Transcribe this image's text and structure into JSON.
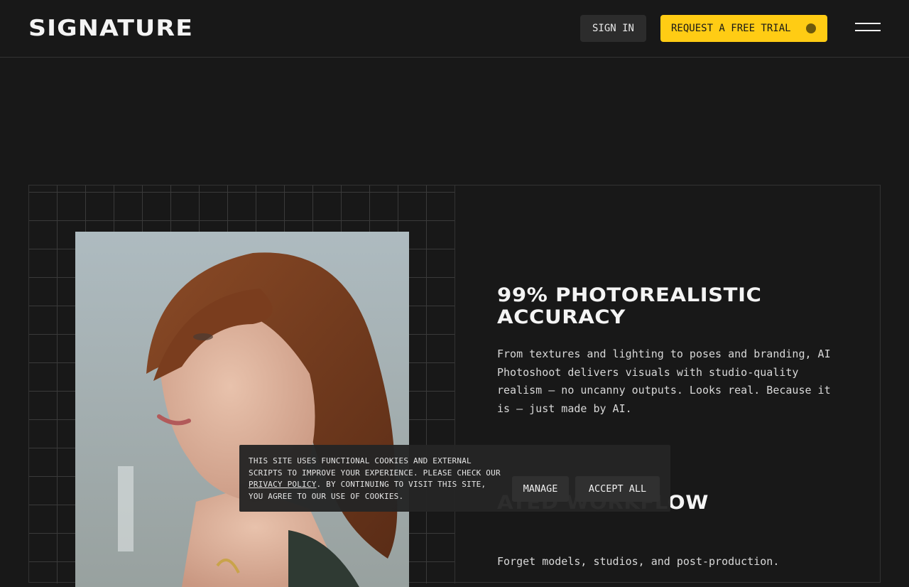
{
  "header": {
    "logo": "SIGNATURE",
    "sign_in_label": "SIGN IN",
    "trial_label": "REQUEST A FREE TRIAL",
    "menu_icon": "hamburger-menu-icon"
  },
  "features": [
    {
      "title": "99% PHOTOREALISTIC ACCURACY",
      "body": "From textures and lighting to poses and branding, AI Photoshoot delivers visuals with studio-quality realism — no uncanny outputs. Looks real. Because it is — just made by AI."
    },
    {
      "title": "ATED WORKFLOW",
      "body": "Forget models, studios, and post-production."
    }
  ],
  "cookie_banner": {
    "text_before": "THIS SITE USES FUNCTIONAL COOKIES AND EXTERNAL SCRIPTS TO IMPROVE YOUR EXPERIENCE. PLEASE CHECK OUR ",
    "link_text": "PRIVACY POLICY",
    "text_after": ". BY CONTINUING TO VISIT THIS SITE, YOU AGREE TO OUR USE OF COOKIES.",
    "manage_label": "MANAGE",
    "accept_label": "ACCEPT ALL"
  },
  "colors": {
    "background": "#181818",
    "accent": "#ffcc14",
    "button_dark": "#2c2c2c"
  }
}
